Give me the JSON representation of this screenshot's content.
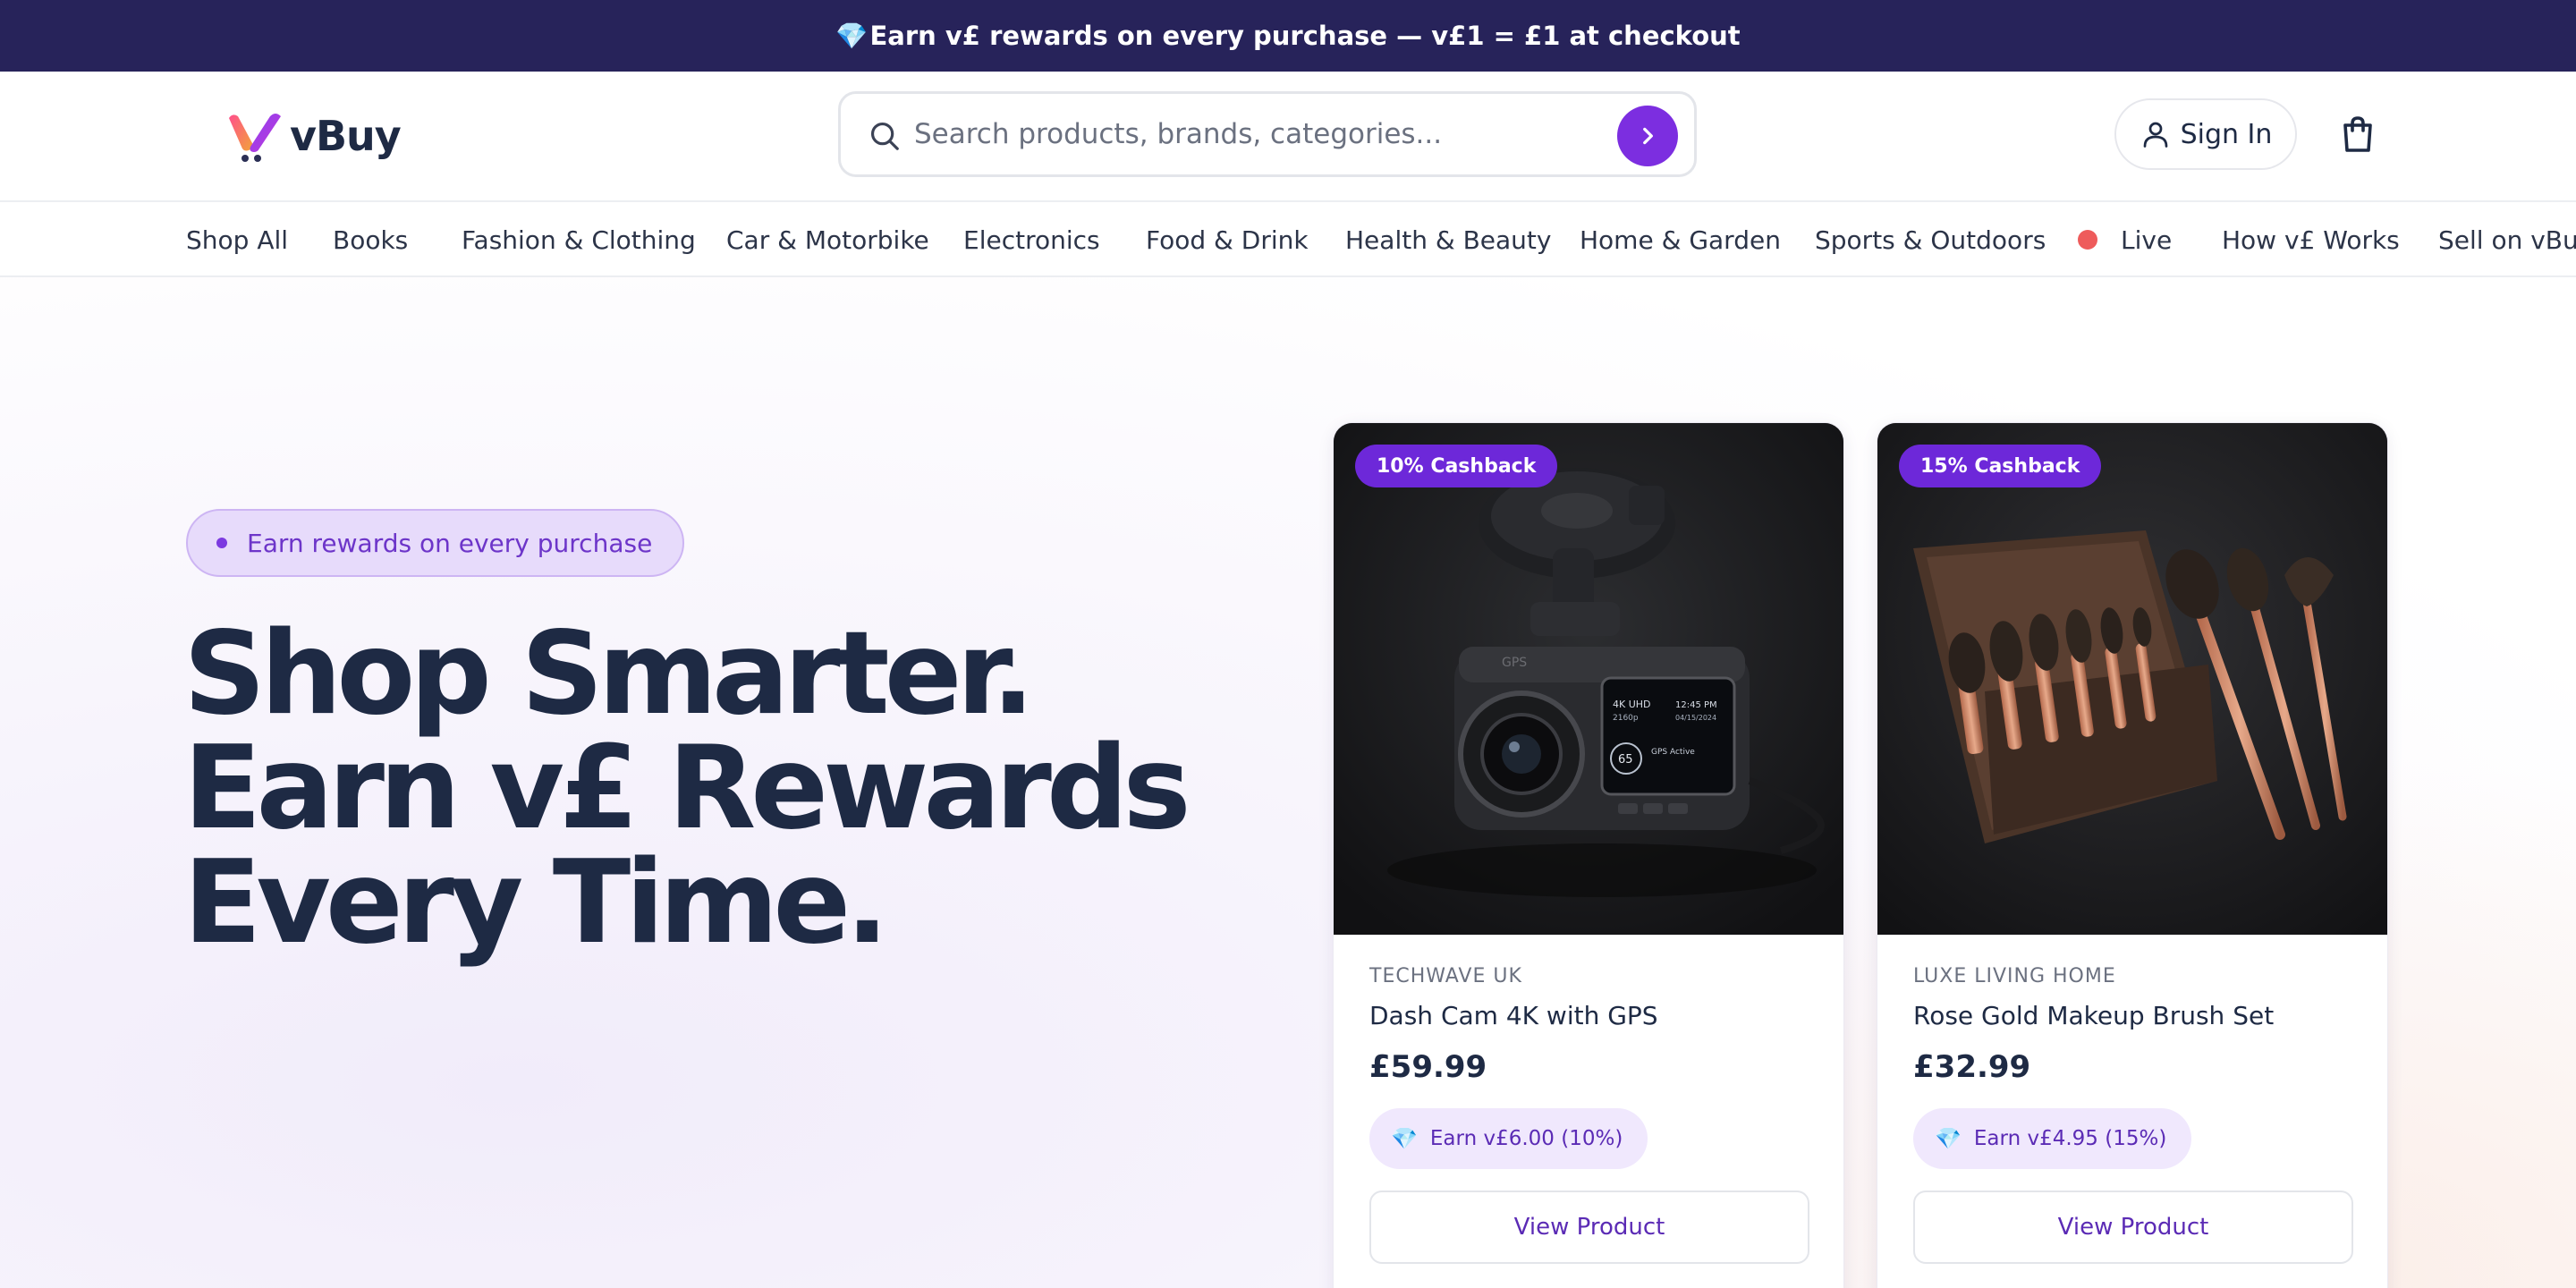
{
  "promo": {
    "gem": "💎",
    "text": "Earn v£ rewards on every purchase — v£1 = £1 at checkout"
  },
  "header": {
    "logo_text": "vBuy",
    "search_placeholder": "Search products, brands, categories...",
    "sign_in": "Sign In",
    "accent": "#7c2ee0"
  },
  "categories": [
    "Shop All",
    "Books",
    "Fashion & Clothing",
    "Car & Motorbike",
    "Electronics",
    "Food & Drink",
    "Health & Beauty",
    "Home & Garden",
    "Sports & Outdoors",
    "Live",
    "How v£ Works",
    "Sell on vBuy"
  ],
  "hero": {
    "pill": "Earn rewards on every purchase",
    "headline": [
      "Shop Smarter.",
      "Earn v£ Rewards",
      "Every Time."
    ]
  },
  "products": [
    {
      "badge": "10% Cashback",
      "brand": "TECHWAVE UK",
      "name": "Dash Cam 4K with GPS",
      "price": "£59.99",
      "earn": "Earn v£6.00 (10%)",
      "button": "View Product",
      "image": "dash-cam-image",
      "screen": {
        "l1": "4K UHD",
        "l2": "2160p",
        "time": "12:45 PM",
        "date": "04/15/2024",
        "speed": "65",
        "gps": "GPS Active",
        "brandmark": "GPS"
      }
    },
    {
      "badge": "15% Cashback",
      "brand": "LUXE LIVING HOME",
      "name": "Rose Gold Makeup Brush Set",
      "price": "£32.99",
      "earn": "Earn v£4.95 (15%)",
      "button": "View Product",
      "image": "makeup-brush-image"
    }
  ],
  "icons": {
    "gem": "💎"
  }
}
